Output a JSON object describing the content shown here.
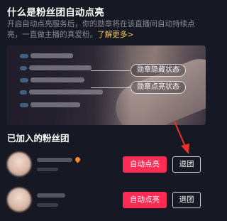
{
  "info": {
    "title": "什么是粉丝团自动点亮",
    "description": "开启自动点亮服务后，你的勋章将在该直播间自动持续点亮，一直做主播的真爱粉。",
    "learn_more": "了解更多>"
  },
  "preview": {
    "badge_hidden_label": "勋章隐藏状态",
    "badge_lit_label": "勋章点亮状态"
  },
  "joined": {
    "section_title": "已加入的粉丝团",
    "clubs": [
      {
        "auto_light_label": "自动点亮",
        "quit_label": "退团"
      },
      {
        "auto_light_label": "自动点亮",
        "quit_label": "退团"
      }
    ]
  },
  "colors": {
    "background": "#161823",
    "accent": "#fe2c55",
    "link": "#f0c75e",
    "annotation_arrow": "#e5332a"
  }
}
